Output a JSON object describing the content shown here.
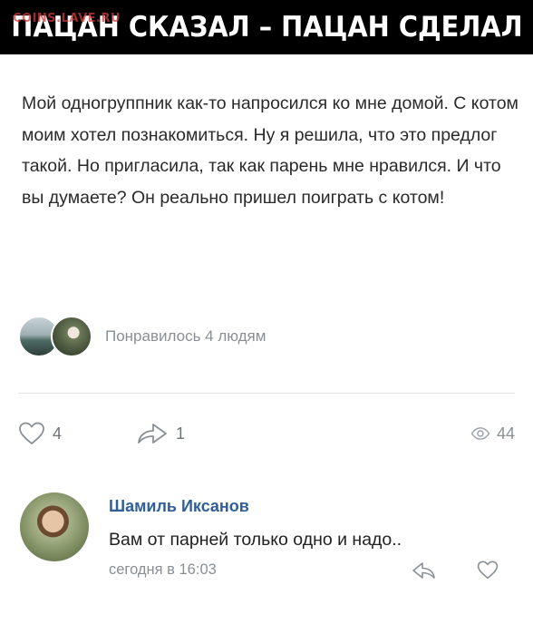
{
  "banner": {
    "title": "ПАЦАН СКАЗАЛ – ПАЦАН СДЕЛАЛ",
    "watermark": "COINS.LAVE.RU"
  },
  "post": {
    "text": "Мой одногруппник как-то напросился ко мне домой. С котом моим хотел познакомиться. Ну я решила, что это предлог такой. Но пригласила, так как парень мне нравился. И что вы думаете? Он реально пришел поиграть с котом!",
    "likes_text": "Понравилось 4 людям",
    "like_count": "4",
    "share_count": "1",
    "views_count": "44"
  },
  "icons": {
    "like": "heart-icon",
    "share": "share-arrow-icon",
    "views": "eye-icon",
    "reply": "reply-arrow-icon"
  },
  "comment": {
    "author": "Шамиль Иксанов",
    "text": "Вам от парней только одно и надо..",
    "time": "сегодня в 16:03"
  },
  "colors": {
    "banner_bg": "#000000",
    "author_link": "#2f5f98",
    "muted": "#8a8f96"
  }
}
